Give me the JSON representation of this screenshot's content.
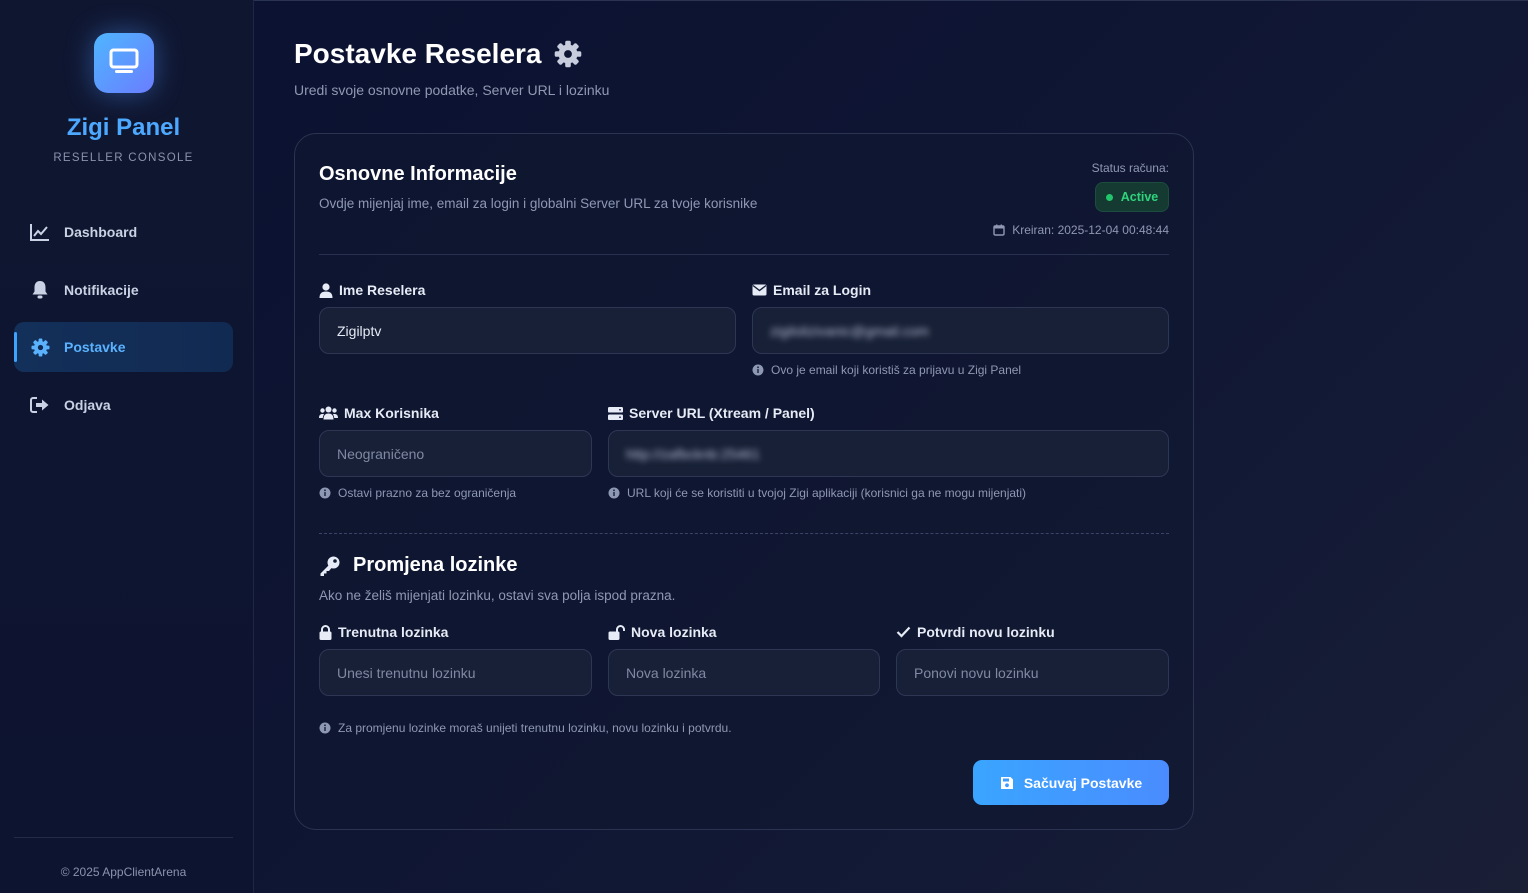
{
  "brand": {
    "title": "Zigi Panel",
    "subtitle": "RESELLER CONSOLE",
    "icon": "monitor-icon"
  },
  "nav": [
    {
      "label": "Dashboard",
      "icon": "chart-line-icon",
      "active": false
    },
    {
      "label": "Notifikacije",
      "icon": "bell-icon",
      "active": false
    },
    {
      "label": "Postavke",
      "icon": "gear-icon",
      "active": true
    },
    {
      "label": "Odjava",
      "icon": "logout-icon",
      "active": false
    }
  ],
  "footer": {
    "copyright": "© 2025 AppClientArena"
  },
  "page": {
    "title": "Postavke Reselera",
    "subtitle": "Uredi svoje osnovne podatke, Server URL i lozinku"
  },
  "basic": {
    "title": "Osnovne Informacije",
    "subtitle": "Ovdje mijenjaj ime, email za login i globalni Server URL za tvoje korisnike",
    "status_label": "Status računa:",
    "status_value": "Active",
    "created": "Kreiran: 2025-12-04 00:48:44"
  },
  "fields": {
    "name": {
      "label": "Ime Reselera",
      "value": "Zigilptv"
    },
    "email": {
      "label": "Email za Login",
      "value": "zigilolizivanic@gmail.com",
      "hint": "Ovo je email koji koristiš za prijavu u Zigi Panel"
    },
    "max_users": {
      "label": "Max Korisnika",
      "placeholder": "Neograničeno",
      "hint": "Ostavi prazno za bez ograničenja"
    },
    "server_url": {
      "label": "Server URL (Xtream / Panel)",
      "value": "http://zafbcknb:25461",
      "hint": "URL koji će se koristiti u tvojoj Zigi aplikaciji (korisnici ga ne mogu mijenjati)"
    }
  },
  "password": {
    "title": "Promjena lozinke",
    "subtitle": "Ako ne želiš mijenjati lozinku, ostavi sva polja ispod prazna.",
    "current": {
      "label": "Trenutna lozinka",
      "placeholder": "Unesi trenutnu lozinku"
    },
    "new": {
      "label": "Nova lozinka",
      "placeholder": "Nova lozinka"
    },
    "confirm": {
      "label": "Potvrdi novu lozinku",
      "placeholder": "Ponovi novu lozinku"
    },
    "hint": "Za promjenu lozinke moraš unijeti trenutnu lozinku, novu lozinku i potvrdu."
  },
  "actions": {
    "save_label": "Sačuvaj Postavke"
  },
  "colors": {
    "accent": "#3ea2ff",
    "success": "#2fd37c",
    "background": "#0e1533"
  }
}
